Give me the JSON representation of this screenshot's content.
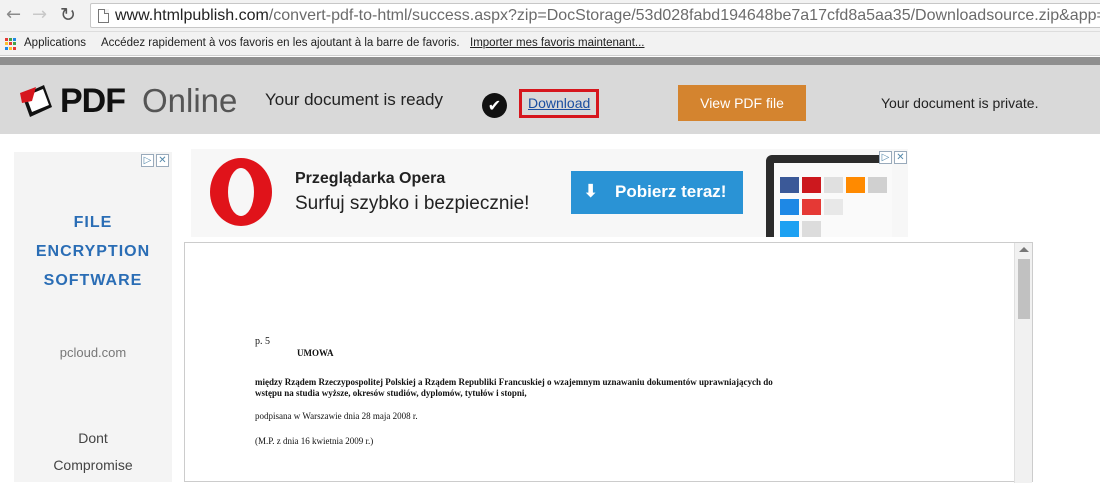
{
  "browser": {
    "url_domain": "www.htmlpublish.com",
    "url_rest": "/convert-pdf-to-html/success.aspx?zip=DocStorage/53d028fabd194648be7a17cfd8a5aa35/Downloadsource.zip&app=p",
    "bookmarks": {
      "apps": "Applications",
      "hint": "Accédez rapidement à vos favoris en les ajoutant à la barre de favoris.",
      "import_link": "Importer mes favoris maintenant..."
    }
  },
  "header": {
    "logo_pdf": "PDF",
    "logo_online": "Online",
    "status": "Your document is ready",
    "download": "Download",
    "view_button": "View PDF file",
    "privacy": "Your document is private."
  },
  "left_ad": {
    "title_lines": [
      "FILE",
      "ENCRYPTION",
      "SOFTWARE"
    ],
    "domain": "pcloud.com",
    "tag_lines": [
      "Dont",
      "Compromise"
    ]
  },
  "top_ad": {
    "title": "Przeglądarka Opera",
    "subtitle": "Surfuj szybko i bezpiecznie!",
    "button": "Pobierz teraz!"
  },
  "document": {
    "mark": "p. 5",
    "heading": "UMOWA",
    "lines": [
      "między Rządem Rzeczypospolitej Polskiej a Rządem Republiki Francuskiej o wzajemnym uznawaniu dokumentów uprawniających do",
      "wstępu na studia wyższe, okresów studiów, dyplomów, tytułów i stopni,",
      "podpisana w Warszawie dnia 28 maja 2008 r.",
      "(M.P. z dnia 16 kwietnia 2009 r.)"
    ]
  },
  "colors": {
    "header_bg": "#d9d9d9",
    "view_button": "#d4842f",
    "download_highlight": "#d6161d",
    "ad_button": "#2a93d5",
    "opera_red": "#e0131a",
    "left_ad_title": "#2a6db5"
  }
}
